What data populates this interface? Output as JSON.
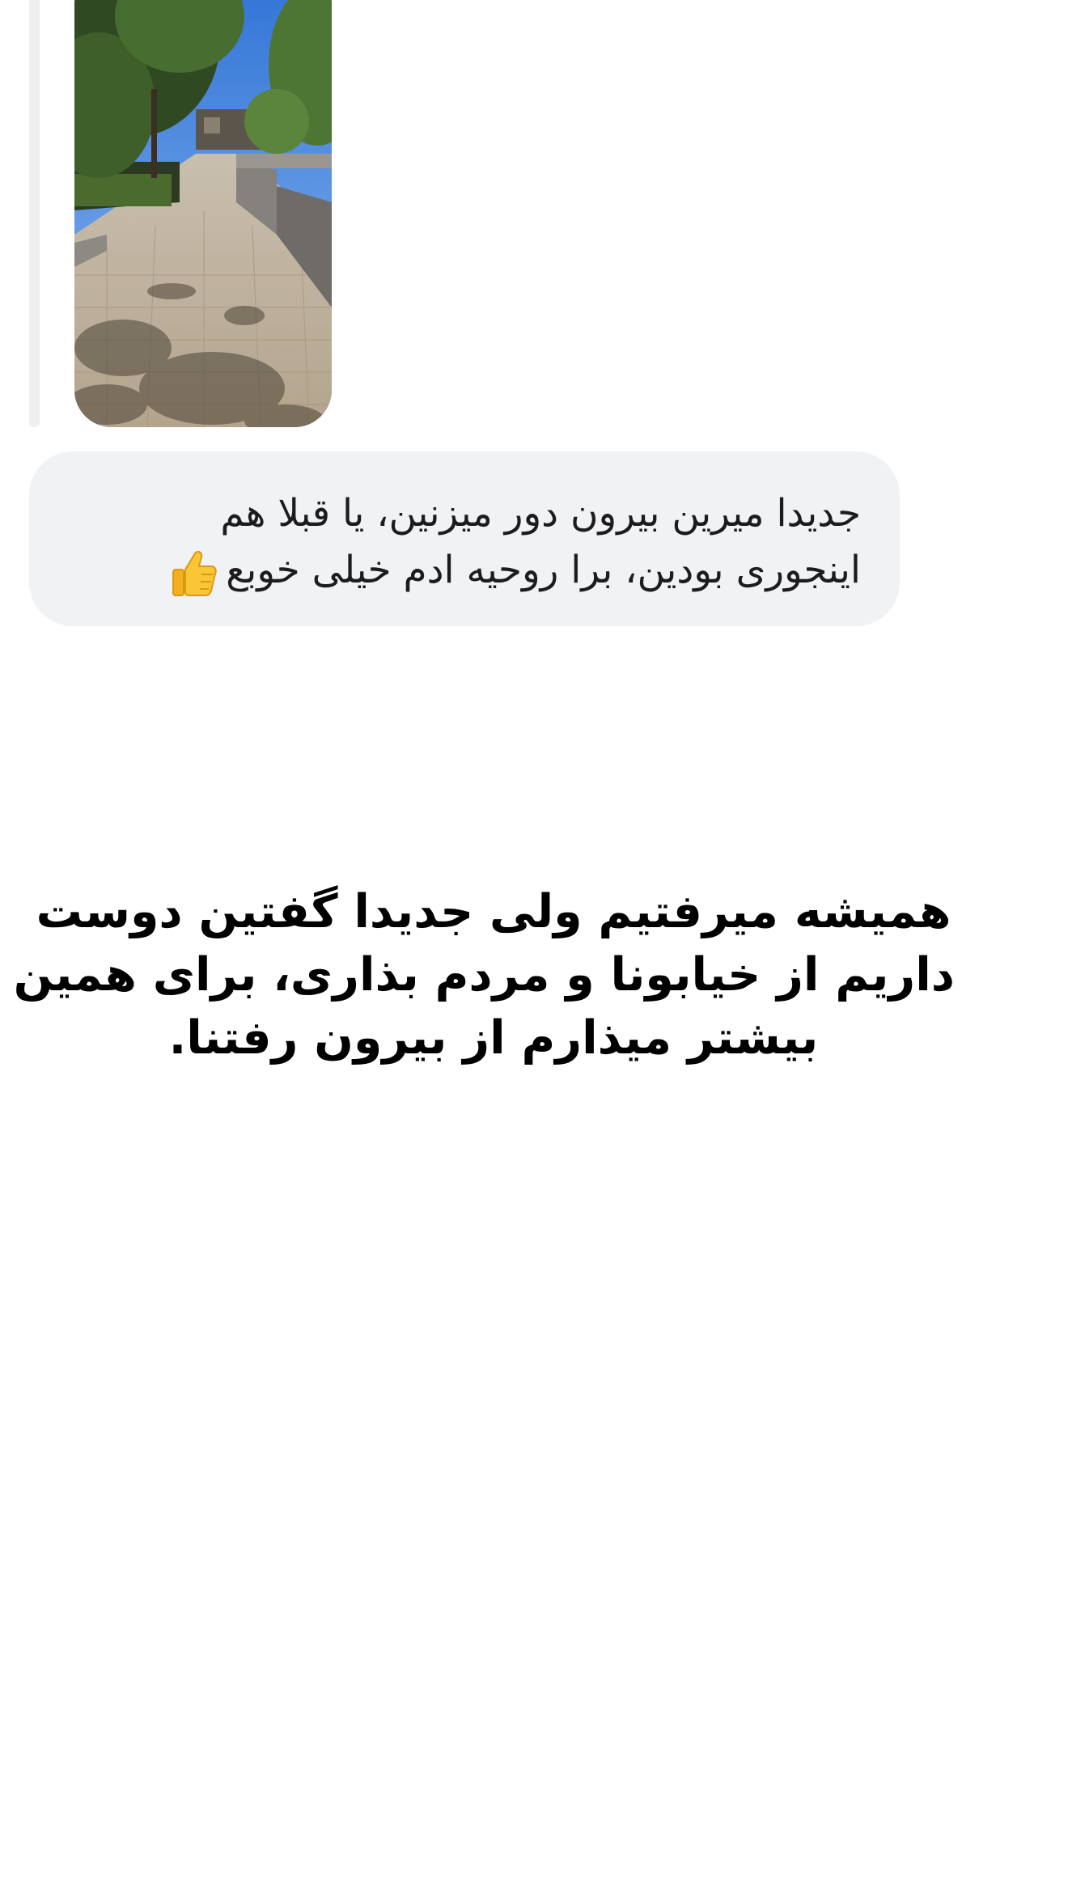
{
  "shared_photo": {
    "subject": "sunlit paved walkway between planters and trees"
  },
  "message": {
    "lines": [
      "جدیدا میرین بیرون دور میزنین، یا قبلا هم",
      "اینجوری بودین، برا روحیه ادم خیلی خوبع"
    ],
    "emoji_icon": "thumbs-up-icon"
  },
  "caption": {
    "lines": [
      "همیشه میرفتیم ولی جدیدا گفتین دوست",
      "داریم از خیابونا و مردم بذاری، برای همین",
      "بیشتر میذارم از بیرون رفتنا."
    ]
  },
  "colors": {
    "background": "#ffffff",
    "bubble": "#f1f2f4",
    "reply_bar": "#eeeff1",
    "text": "#1c1c1e"
  }
}
